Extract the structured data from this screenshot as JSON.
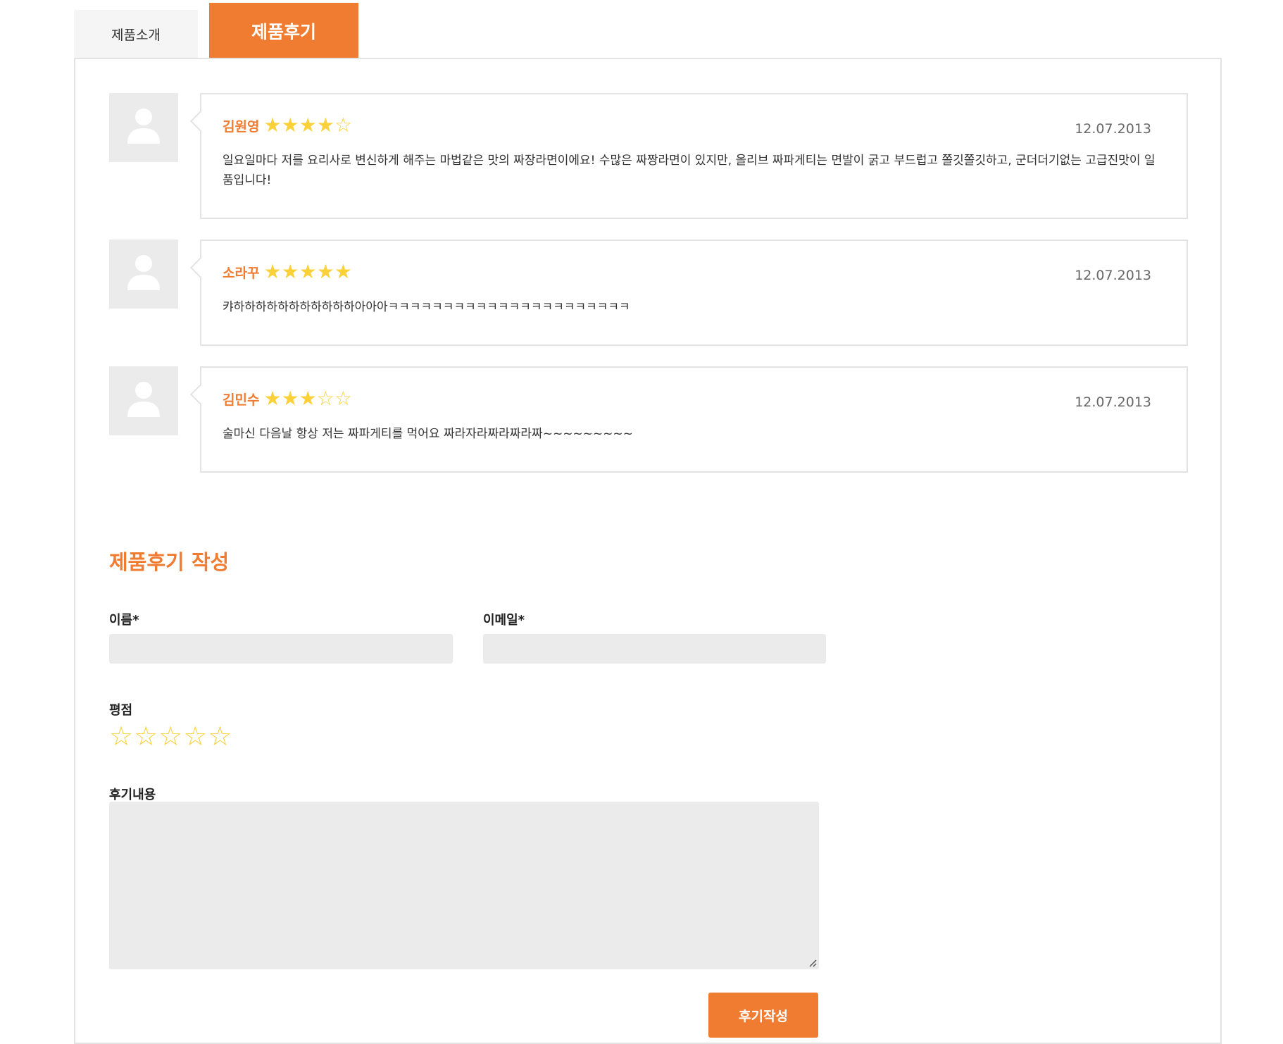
{
  "tabs": [
    {
      "label": "제품소개",
      "active": false
    },
    {
      "label": "제품후기",
      "active": true
    }
  ],
  "reviews": [
    {
      "name": "김원영",
      "rating": 4,
      "date": "12.07.2013",
      "text": "일요일마다 저를 요리사로 변신하게 해주는 마법같은 맛의 짜장라면이에요! 수많은 짜짱라면이 있지만, 올리브 짜파게티는 면발이 굵고 부드럽고 쫄깃쫄깃하고, 군더더기없는 고급진맛이 일품입니다!"
    },
    {
      "name": "소라꾸",
      "rating": 5,
      "date": "12.07.2013",
      "text": "캬하하하하하하하하하하하아아아ㅋㅋㅋㅋㅋㅋㅋㅋㅋㅋㅋㅋㅋㅋㅋㅋㅋㅋㅋㅋㅋㅋ"
    },
    {
      "name": "김민수",
      "rating": 3,
      "date": "12.07.2013",
      "text": "술마신 다음날 항상 저는 짜파게티를 먹어요 짜라자라짜라짜라짜~~~~~~~~~"
    }
  ],
  "form": {
    "title": "제품후기 작성",
    "name_label": "이름*",
    "name_value": "",
    "email_label": "이메일*",
    "email_value": "",
    "rating_label": "평점",
    "rating_value": 0,
    "content_label": "후기내용",
    "content_value": "",
    "submit_label": "후기작성"
  },
  "colors": {
    "accent": "#f07c32",
    "star": "#fbd13a",
    "field_bg": "#ebebeb",
    "border": "#e3e3e3"
  },
  "icons": {
    "avatar": "user-silhouette-icon",
    "star_filled": "★",
    "star_empty": "☆"
  }
}
